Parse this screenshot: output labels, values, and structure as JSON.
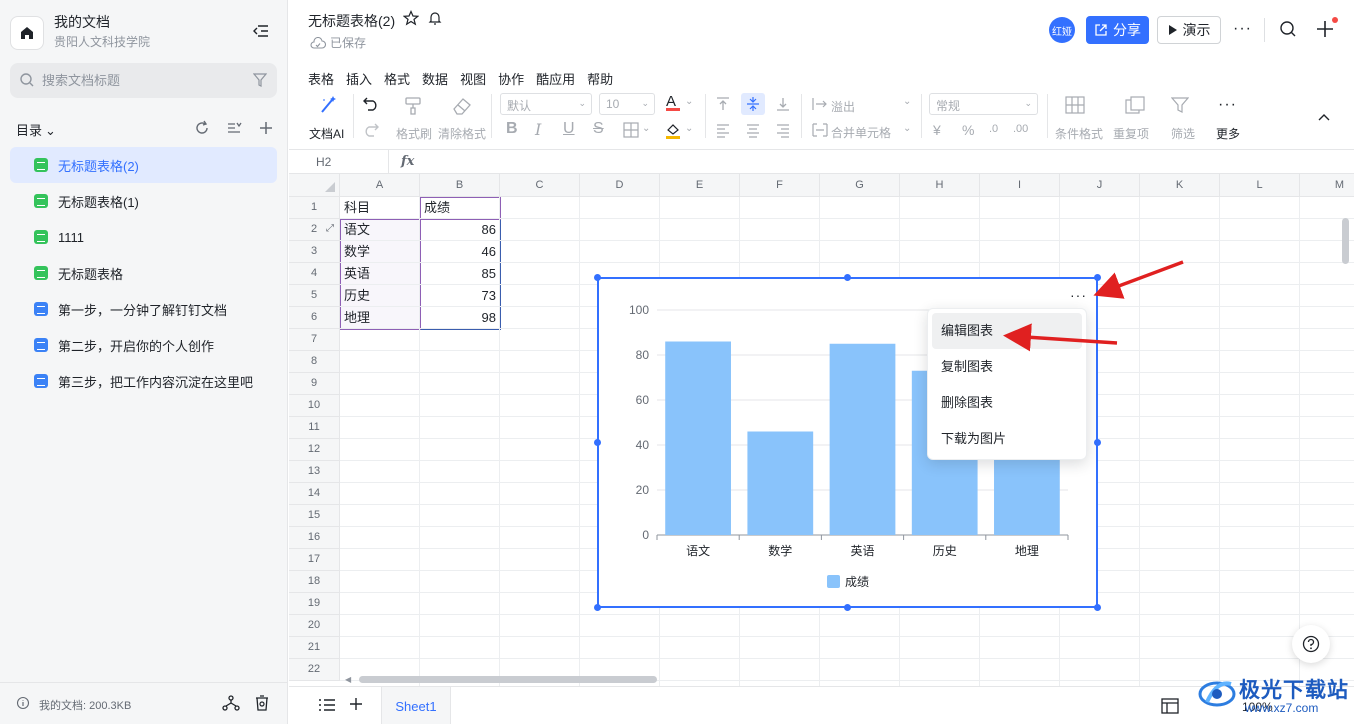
{
  "workspace": {
    "title": "我的文档",
    "subtitle": "贵阳人文科技学院"
  },
  "search": {
    "placeholder": "搜索文档标题"
  },
  "toc": {
    "title": "目录"
  },
  "docs": [
    {
      "label": "无标题表格(2)",
      "type": "sheet"
    },
    {
      "label": "无标题表格(1)",
      "type": "sheet"
    },
    {
      "label": "1111",
      "type": "sheet"
    },
    {
      "label": "无标题表格",
      "type": "sheet"
    },
    {
      "label": "第一步，一分钟了解钉钉文档",
      "type": "doc"
    },
    {
      "label": "第二步，开启你的个人创作",
      "type": "doc"
    },
    {
      "label": "第三步，把工作内容沉淀在这里吧",
      "type": "doc"
    }
  ],
  "sidebar_footer": {
    "size": "我的文档: 200.3KB"
  },
  "document": {
    "title": "无标题表格(2)",
    "saved": "已保存"
  },
  "topbar": {
    "avatar": "红娅",
    "share": "分享",
    "present": "演示"
  },
  "menu": [
    "表格",
    "插入",
    "格式",
    "数据",
    "视图",
    "协作",
    "酷应用",
    "帮助"
  ],
  "toolbar": {
    "ai": "文档AI",
    "format_painter": "格式刷",
    "clear_format": "清除格式",
    "font": "默认",
    "font_size": "10",
    "overflow": "溢出",
    "merge": "合并单元格",
    "number_format": "常规",
    "conditional": "条件格式",
    "duplicates": "重复项",
    "filter": "筛选",
    "more": "更多"
  },
  "formula_bar": {
    "cell_ref": "H2",
    "fx": "fx"
  },
  "columns": [
    "A",
    "B",
    "C",
    "D",
    "E",
    "F",
    "G",
    "H",
    "I",
    "J",
    "K",
    "L",
    "M"
  ],
  "rows": [
    "1",
    "2",
    "3",
    "4",
    "5",
    "6",
    "7",
    "8",
    "9",
    "10",
    "11",
    "12",
    "13",
    "14",
    "15",
    "16",
    "17",
    "18",
    "19",
    "20",
    "21",
    "22"
  ],
  "table": {
    "header": [
      "科目",
      "成绩"
    ],
    "rows": [
      [
        "语文",
        "86"
      ],
      [
        "数学",
        "46"
      ],
      [
        "英语",
        "85"
      ],
      [
        "历史",
        "73"
      ],
      [
        "地理",
        "98"
      ]
    ]
  },
  "chart_data": {
    "type": "bar",
    "categories": [
      "语文",
      "数学",
      "英语",
      "历史",
      "地理"
    ],
    "series": [
      {
        "name": "成绩",
        "values": [
          86,
          46,
          85,
          73,
          98
        ],
        "color": "#89c3fb"
      }
    ],
    "yticks": [
      "0",
      "20",
      "40",
      "60",
      "80",
      "100"
    ],
    "ylim": [
      0,
      100
    ],
    "grid": true,
    "legend": "bottom"
  },
  "context_menu": {
    "items": [
      "编辑图表",
      "复制图表",
      "删除图表",
      "下载为图片"
    ]
  },
  "bottom": {
    "sheet": "Sheet1",
    "zoom": "100%"
  },
  "watermark": {
    "text": "极光下载站",
    "url": "www.xz7.com"
  },
  "colors": {
    "accent": "#3370ff",
    "bar": "#89c3fb",
    "arrow": "#e02020"
  }
}
